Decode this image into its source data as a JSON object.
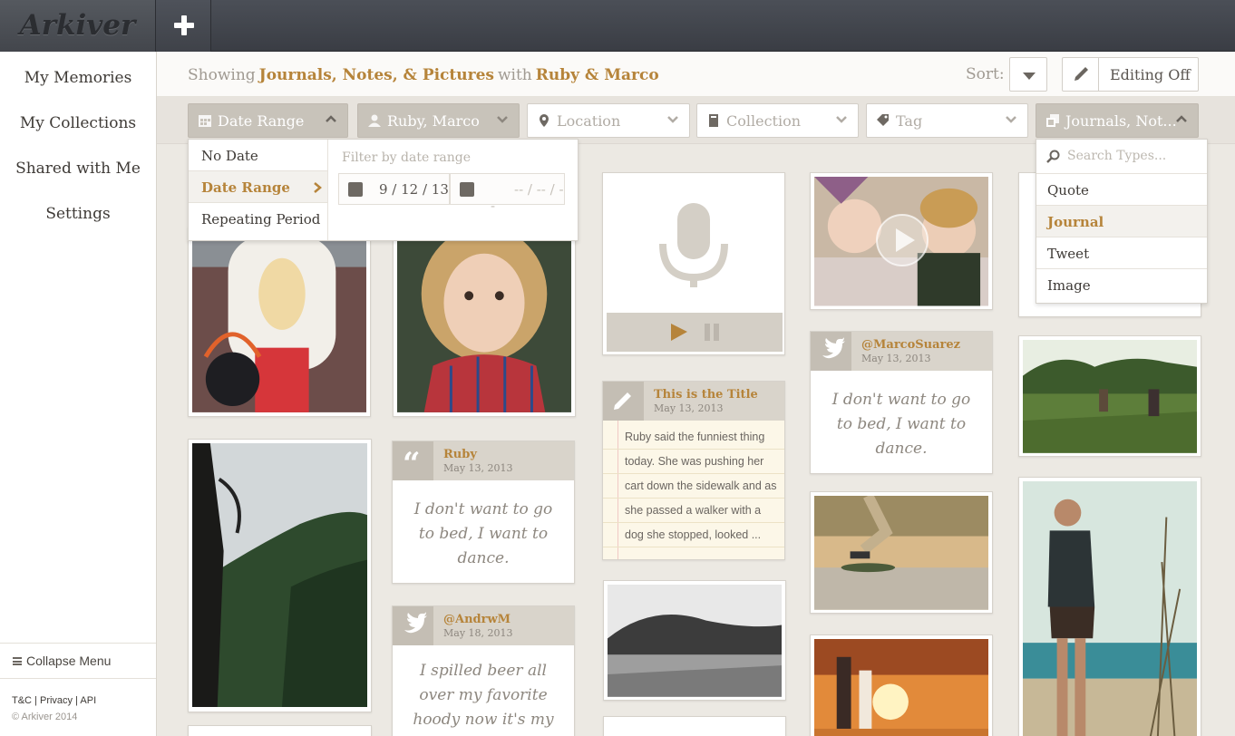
{
  "app": {
    "logo": "Arkiver"
  },
  "sidebar": {
    "items": [
      {
        "label": "My Memories"
      },
      {
        "label": "My Collections"
      },
      {
        "label": "Shared with Me"
      },
      {
        "label": "Settings"
      }
    ],
    "collapse": "Collapse Menu",
    "links": [
      "T&C",
      "Privacy",
      "API"
    ],
    "copyright": "© Arkiver 2014"
  },
  "header": {
    "showing": "Showing",
    "types": "Journals, Notes, & Pictures",
    "with": "with",
    "people": "Ruby & Marco",
    "sort_label": "Sort:",
    "editing": "Editing Off"
  },
  "filters": {
    "date": "Date Range",
    "people": "Ruby, Marco",
    "location": "Location",
    "collection": "Collection",
    "tag": "Tag",
    "types": "Journals, Not..."
  },
  "date_dropdown": {
    "options": [
      "No Date",
      "Date Range",
      "Repeating Period"
    ],
    "selected": "Date Range",
    "filter_label": "Filter by date range",
    "start": "9 / 12 / 13",
    "end": "-- / -- / --"
  },
  "type_dropdown": {
    "placeholder": "Search Types...",
    "options": [
      "Quote",
      "Journal",
      "Tweet",
      "Image"
    ],
    "selected": "Journal"
  },
  "cards": {
    "quote_ruby": {
      "name": "Ruby",
      "date": "May 13, 2013",
      "text": "I don't want to go to bed, I want to dance."
    },
    "tweet_andrw": {
      "name": "@AndrwM",
      "date": "May 18, 2013",
      "text": "I spilled beer all over my favorite hoody now it's my favorite"
    },
    "journal": {
      "name": "This is the Title",
      "date": "May 13, 2013",
      "lines": [
        "Ruby said the funniest thing",
        "today. She was pushing her",
        "cart down the sidewalk and as",
        "she passed a walker with a",
        "dog she stopped, looked ..."
      ]
    },
    "tweet_marco": {
      "name": "@MarcoSuarez",
      "date": "May 13, 2013",
      "text": "I don't want to go to bed, I want to dance."
    }
  },
  "colors": {
    "accent": "#b6843a",
    "topbar": "#43464c",
    "card_header": "#d9d4cb"
  }
}
